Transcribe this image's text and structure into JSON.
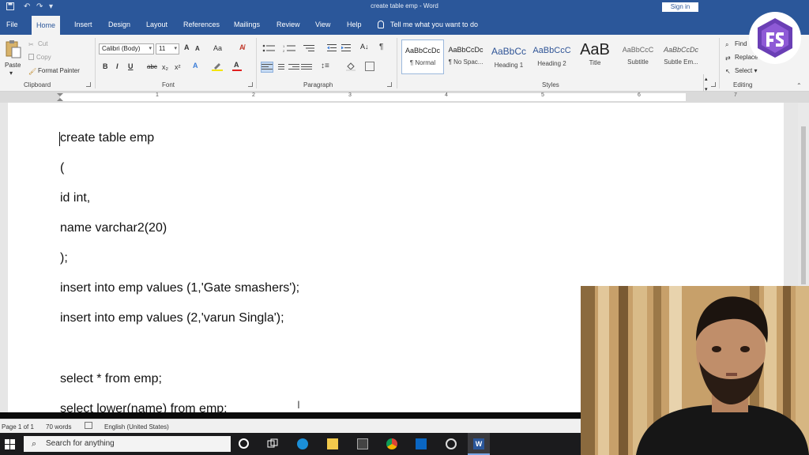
{
  "window": {
    "title": "create table emp  -  Word",
    "sign_in": "Sign in"
  },
  "menu": {
    "tabs": [
      "File",
      "Home",
      "Insert",
      "Design",
      "Layout",
      "References",
      "Mailings",
      "Review",
      "View",
      "Help"
    ],
    "tell_me": "Tell me what you want to do"
  },
  "ribbon": {
    "clipboard": {
      "label": "Clipboard",
      "paste": "Paste",
      "cut": "Cut",
      "copy": "Copy",
      "format_painter": "Format Painter"
    },
    "font": {
      "label": "Font",
      "font_name": "Calibri (Body)",
      "font_size": "11",
      "grow": "A",
      "shrink": "A",
      "case": "Aa",
      "bold": "B",
      "italic": "I",
      "underline": "U",
      "strike": "abc",
      "subscript": "x₂",
      "superscript": "x²"
    },
    "paragraph": {
      "label": "Paragraph",
      "pilcrow": "¶"
    },
    "styles": {
      "label": "Styles",
      "items": [
        {
          "preview": "AaBbCcDc",
          "name": "¶ Normal"
        },
        {
          "preview": "AaBbCcDc",
          "name": "¶ No Spac..."
        },
        {
          "preview": "AaBbCc",
          "name": "Heading 1"
        },
        {
          "preview": "AaBbCcC",
          "name": "Heading 2"
        },
        {
          "preview": "AaB",
          "name": "Title"
        },
        {
          "preview": "AaBbCcC",
          "name": "Subtitle"
        },
        {
          "preview": "AaBbCcDc",
          "name": "Subtle Em..."
        }
      ]
    },
    "editing": {
      "label": "Editing",
      "find": "Find",
      "replace": "Replace",
      "select": "Select"
    }
  },
  "ruler": {
    "numbers": [
      "1",
      "2",
      "3",
      "4",
      "5",
      "6",
      "7"
    ]
  },
  "document": {
    "lines": [
      "create table emp",
      "(",
      "id int,",
      "name varchar2(20)",
      ");",
      "insert into emp values (1,'Gate smashers');",
      "insert into emp values (2,'varun Singla');",
      "",
      "select * from emp;",
      "select lower(name) from emp;"
    ]
  },
  "status": {
    "page": "Page 1 of 1",
    "words": "70 words",
    "language": "English (United States)"
  },
  "taskbar": {
    "search_placeholder": "Search for anything"
  },
  "colors": {
    "word_blue": "#2b579a",
    "ribbon_bg": "#f3f3f3",
    "logo_purple": "#6a3fb5"
  }
}
